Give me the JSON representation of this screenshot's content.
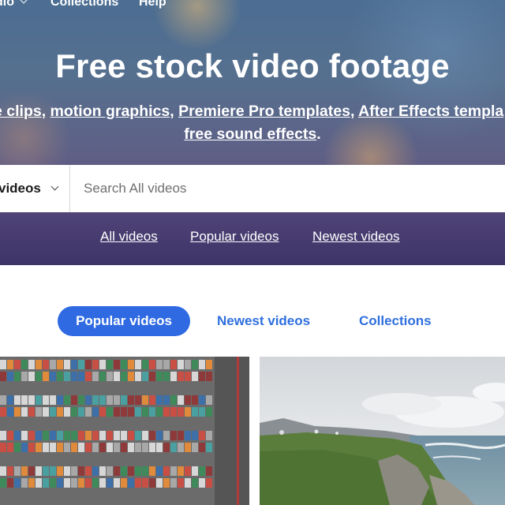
{
  "nav": {
    "studio_label": "dio",
    "collections_label": "Collections",
    "help_label": "Help"
  },
  "hero": {
    "title": "Free stock video footage",
    "links_line1": [
      {
        "text": "e clips"
      },
      {
        "text": "motion graphics"
      },
      {
        "text": "Premiere Pro templates"
      },
      {
        "text": "After Effects templa"
      }
    ],
    "separators": [
      ", ",
      ", ",
      ", "
    ],
    "sound_effects_link": "free sound effects",
    "sound_effects_suffix": "."
  },
  "search": {
    "category_label": "videos",
    "placeholder": "Search All videos"
  },
  "quick_links": {
    "all": "All videos",
    "popular": "Popular videos",
    "newest": "Newest videos"
  },
  "tabs": {
    "popular": "Popular videos",
    "newest": "Newest videos",
    "collections": "Collections"
  },
  "colors": {
    "accent": "#2f6ae3",
    "link": "#2f6fde"
  },
  "thumbnails": [
    {
      "subject": "aerial shipping container port"
    },
    {
      "subject": "green coastline with ocean waves"
    }
  ]
}
